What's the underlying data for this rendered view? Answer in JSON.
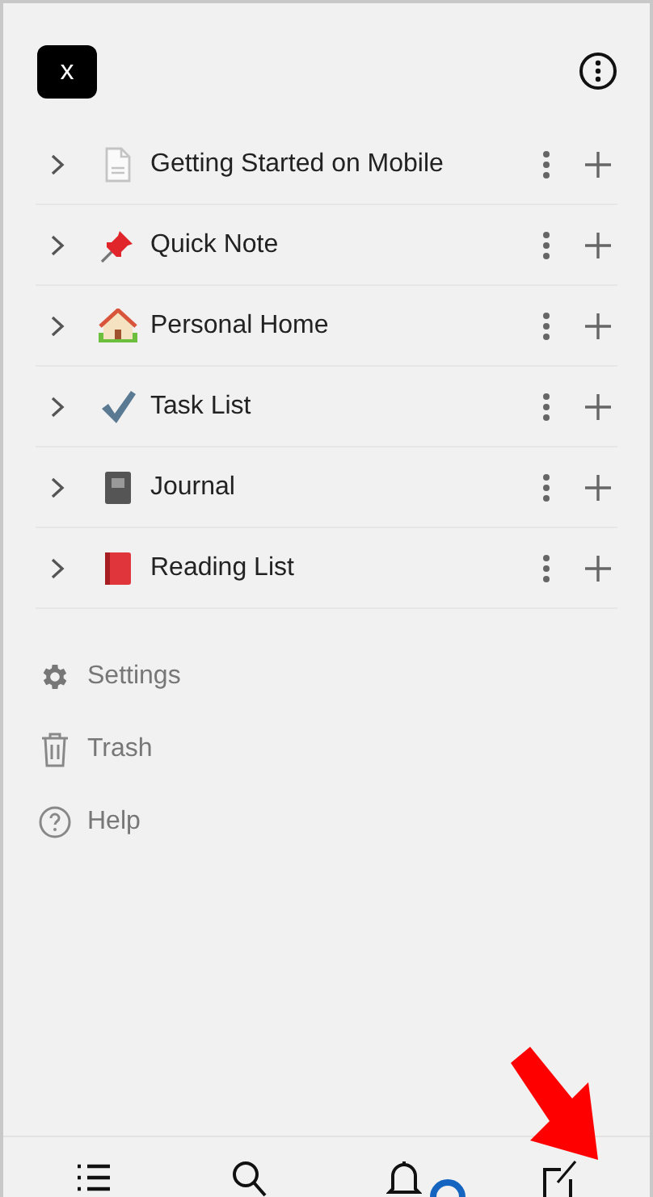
{
  "logo": {
    "label": "x"
  },
  "pages": [
    {
      "kind": "document",
      "title": "Getting Started on Mobile"
    },
    {
      "kind": "pin",
      "title": "Quick Note"
    },
    {
      "kind": "house",
      "title": "Personal Home"
    },
    {
      "kind": "check",
      "title": "Task List"
    },
    {
      "kind": "notebook",
      "title": "Journal"
    },
    {
      "kind": "book",
      "title": "Reading List"
    }
  ],
  "menu": [
    {
      "kind": "settings",
      "label": "Settings"
    },
    {
      "kind": "trash",
      "label": "Trash"
    },
    {
      "kind": "help",
      "label": "Help"
    }
  ],
  "bottom_nav": [
    {
      "kind": "list"
    },
    {
      "kind": "search"
    },
    {
      "kind": "bell"
    },
    {
      "kind": "compose"
    }
  ]
}
